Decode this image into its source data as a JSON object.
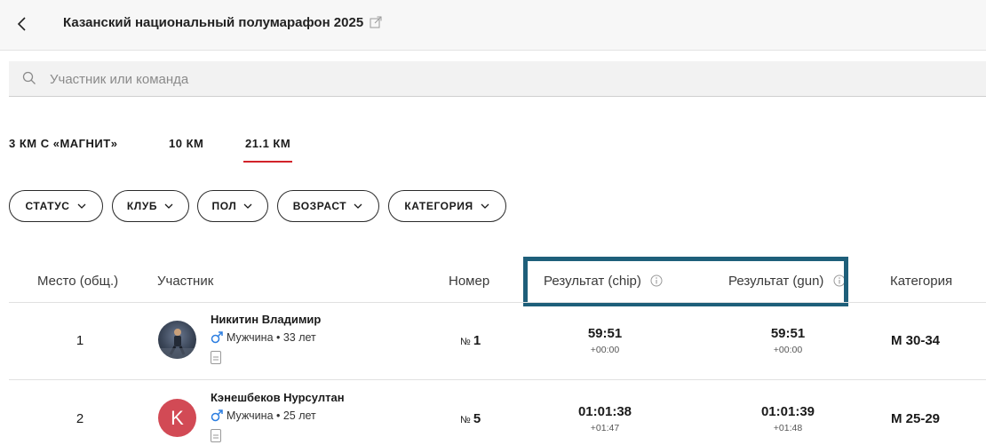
{
  "header": {
    "back_label": "<",
    "title": "Казанский национальный полумарафон 2025"
  },
  "search": {
    "placeholder": "Участник или команда"
  },
  "tabs": [
    {
      "label": "3 КМ С «МАГНИТ»",
      "active": false
    },
    {
      "label": "10 КМ",
      "active": false
    },
    {
      "label": "21.1 КМ",
      "active": true
    }
  ],
  "filters": [
    "СТАТУС",
    "КЛУБ",
    "ПОЛ",
    "ВОЗРАСТ",
    "КАТЕГОРИЯ"
  ],
  "table": {
    "columns": {
      "place": "Место (общ.)",
      "participant": "Участник",
      "bib": "Номер",
      "result_chip": "Результат (chip)",
      "result_gun": "Результат (gun)",
      "category": "Категория"
    },
    "rows": [
      {
        "place": "1",
        "name": "Никитин Владимир",
        "info": "Мужчина • 33 лет",
        "avatar": "photo",
        "bib_prefix": "№",
        "bib": "1",
        "chip": "59:51",
        "chip_delta": "+00:00",
        "gun": "59:51",
        "gun_delta": "+00:00",
        "category": "М 30-34"
      },
      {
        "place": "2",
        "name": "Кэнешбеков Нурсултан",
        "info": "Мужчина • 25 лет",
        "avatar_letter": "K",
        "bib_prefix": "№",
        "bib": "5",
        "chip": "01:01:38",
        "chip_delta": "+01:47",
        "gun": "01:01:39",
        "gun_delta": "+01:48",
        "category": "М 25-29"
      }
    ]
  },
  "colors": {
    "accent": "#d2232a",
    "highlight_box": "#1e5f7a",
    "avatar_letter_bg": "#d24a55"
  }
}
